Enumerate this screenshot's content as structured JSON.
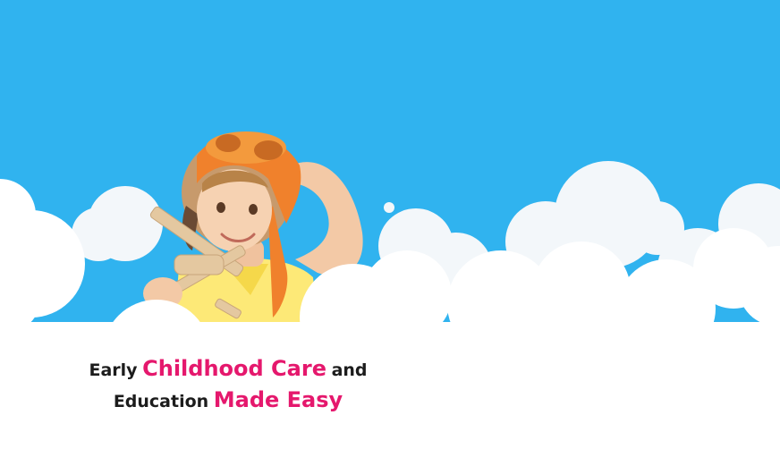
{
  "hero": {
    "headline_line1_a": "Early",
    "headline_line1_b": "Childhood Care",
    "headline_line1_c": "and",
    "headline_line2_a": "Education",
    "headline_line2_b": "Made Easy"
  },
  "colors": {
    "sky": "#30b3ef",
    "cloud": "#ffffff",
    "accent_pink": "#e5186d",
    "text_dark": "#1c1c1c"
  }
}
